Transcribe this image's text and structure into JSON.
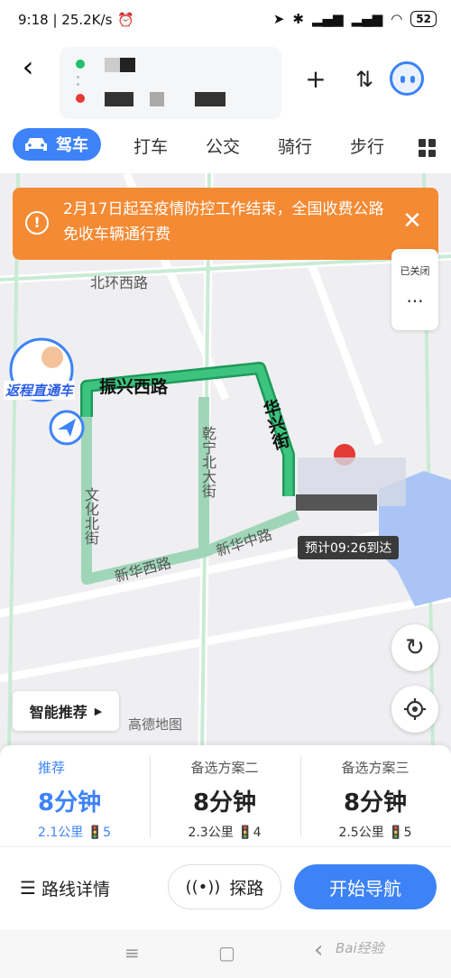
{
  "status_bar": {
    "time_speed": "9:18 | 25.2K/s",
    "battery": "52"
  },
  "header": {
    "back_icon": "chevron-left-icon",
    "add_icon": "plus-icon",
    "swap_icon": "swap-vertical-icon",
    "assistant_icon": "robot-avatar-icon"
  },
  "tabs": {
    "active": "驾车",
    "items": [
      "打车",
      "公交",
      "骑行",
      "步行"
    ],
    "more_icon": "grid-icon"
  },
  "map": {
    "banner": {
      "text": "2月17日起至疫情防控工作结束，全国收费公路免收车辆通行费",
      "close_icon": "close-icon"
    },
    "side_panel": {
      "status": "已关闭",
      "more": "···"
    },
    "roads": [
      "北环西路",
      "振兴西路",
      "华兴街",
      "乾宁北大街",
      "文化北街",
      "新华西路",
      "新华中路"
    ],
    "promo_label": "返程直通车",
    "eta_label": "预计09:26到达",
    "brand_label": "高德地图",
    "smart_recommend": "智能推荐",
    "refresh_icon": "refresh-icon",
    "locate_icon": "locate-icon",
    "colors": {
      "route_main": "#24b46b",
      "route_alt": "#9fd6b8"
    }
  },
  "routes": [
    {
      "title": "推荐",
      "time": "8分钟",
      "distance": "2.1公里",
      "lights": "5"
    },
    {
      "title": "备选方案二",
      "time": "8分钟",
      "distance": "2.3公里",
      "lights": "4"
    },
    {
      "title": "备选方案三",
      "time": "8分钟",
      "distance": "2.5公里",
      "lights": "5"
    }
  ],
  "actions": {
    "detail": "路线详情",
    "probe": "探路",
    "start": "开始导航"
  },
  "nav_bar": {
    "menu": "≡",
    "home": "▢",
    "back": "‹"
  },
  "watermark": "Bai经验"
}
